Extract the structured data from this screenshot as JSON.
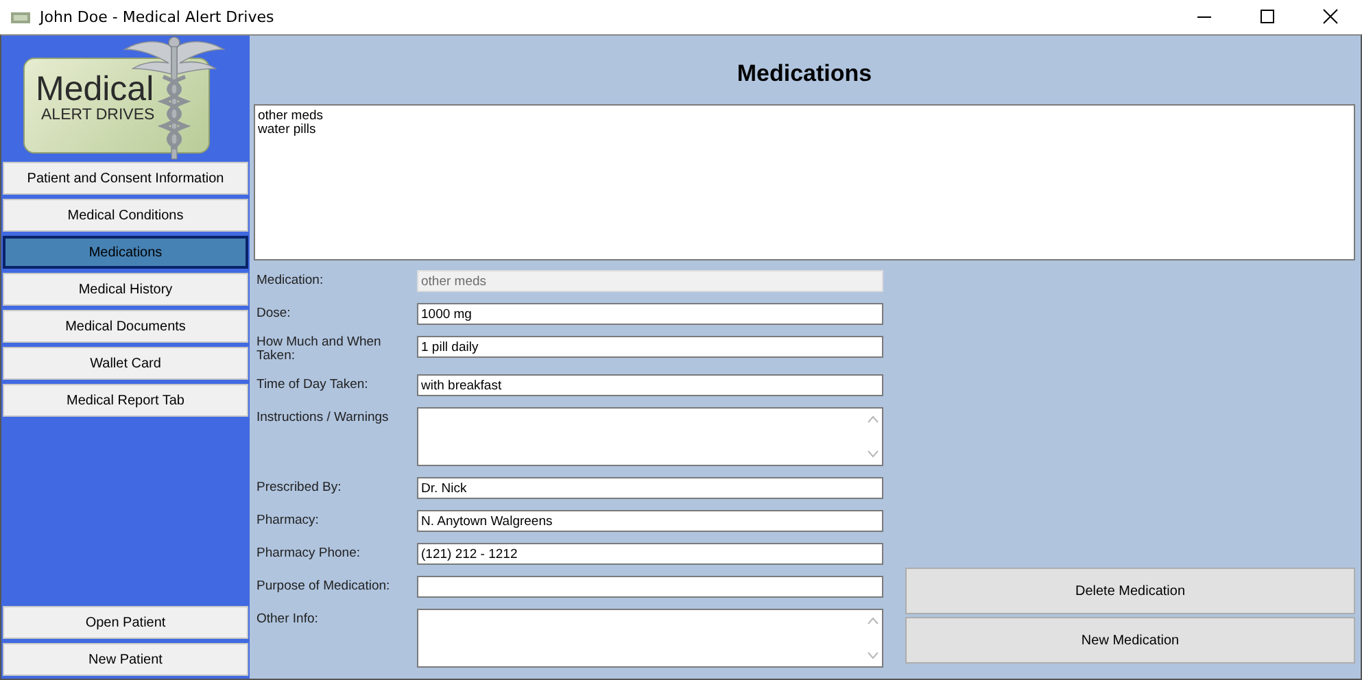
{
  "window": {
    "title": "John Doe - Medical Alert Drives"
  },
  "logo": {
    "line_1": "Medical",
    "line_2": "ALERT DRIVES"
  },
  "nav": [
    {
      "label": "Patient and Consent Information",
      "selected": false
    },
    {
      "label": "Medical Conditions",
      "selected": false
    },
    {
      "label": "Medications",
      "selected": true
    },
    {
      "label": "Medical History",
      "selected": false
    },
    {
      "label": "Medical Documents",
      "selected": false
    },
    {
      "label": "Wallet Card",
      "selected": false
    },
    {
      "label": "Medical Report Tab",
      "selected": false
    }
  ],
  "patient_buttons": [
    "Open Patient",
    "New Patient"
  ],
  "heading": "Medications",
  "medication_list": [
    "other meds",
    "water pills"
  ],
  "fields": [
    {
      "label": "Medication:",
      "kind": "text",
      "value": "other meds",
      "disabled": true
    },
    {
      "label": "Dose:",
      "kind": "text",
      "value": "1000 mg",
      "disabled": false
    },
    {
      "label": "How Much and When Taken:",
      "kind": "text",
      "value": "1 pill daily",
      "disabled": false
    },
    {
      "label": "Time of Day Taken:",
      "kind": "text",
      "value": "with breakfast",
      "disabled": false
    },
    {
      "label": "Instructions / Warnings",
      "kind": "textarea",
      "disabled": false
    },
    {
      "label": "Prescribed By:",
      "kind": "text",
      "value": "Dr. Nick",
      "disabled": false
    },
    {
      "label": "Pharmacy:",
      "kind": "text",
      "value": "N. Anytown Walgreens",
      "disabled": false
    },
    {
      "label": "Pharmacy Phone:",
      "kind": "text",
      "value": "(121) 212 - 1212",
      "disabled": false
    },
    {
      "label": "Purpose of Medication:",
      "kind": "text",
      "disabled": false
    },
    {
      "label": "Other Info:",
      "kind": "textarea",
      "disabled": false
    }
  ],
  "action_buttons": [
    "Delete Medication",
    "New Medication"
  ]
}
